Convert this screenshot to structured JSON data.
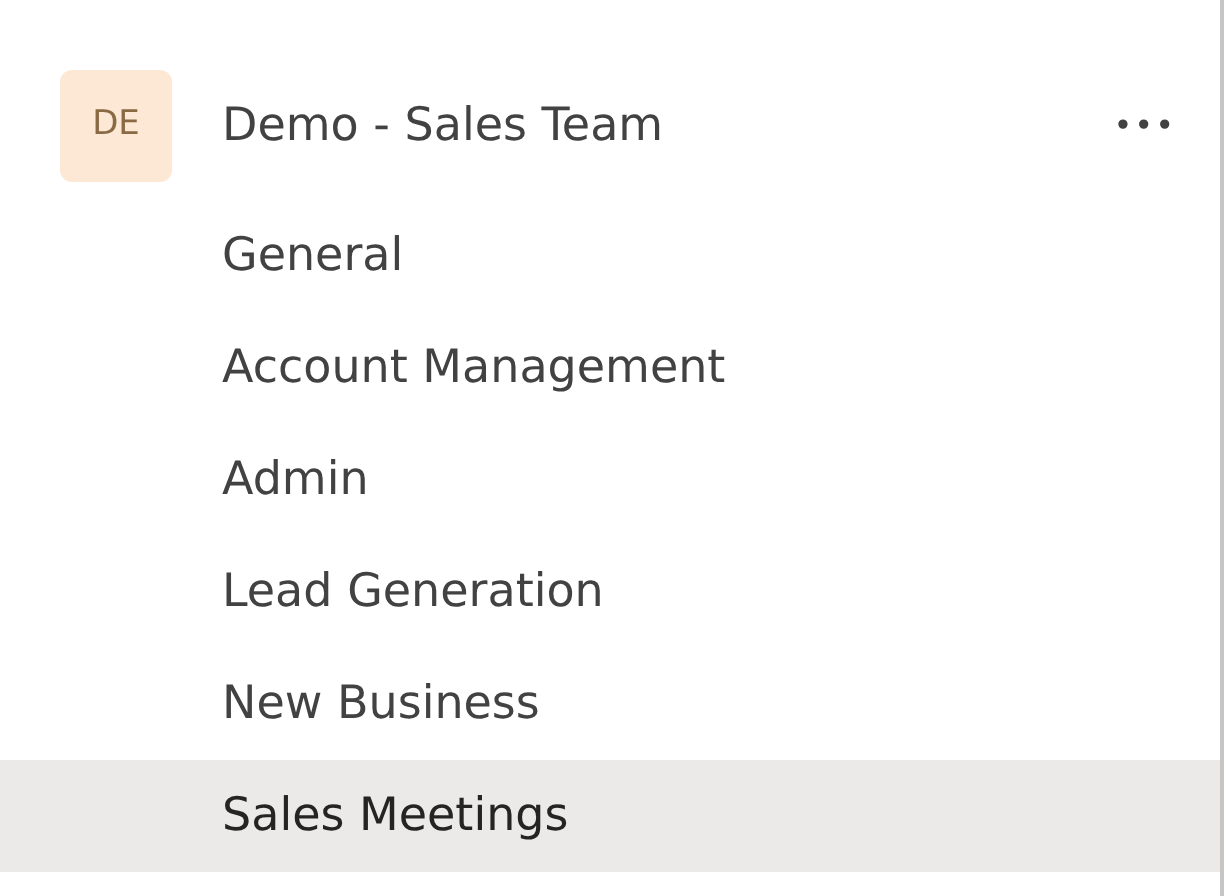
{
  "team": {
    "avatar": "DE",
    "name": "Demo - Sales Team",
    "more": "•••"
  },
  "channels": [
    {
      "name": "General",
      "selected": false
    },
    {
      "name": "Account Management",
      "selected": false
    },
    {
      "name": "Admin",
      "selected": false
    },
    {
      "name": "Lead Generation",
      "selected": false
    },
    {
      "name": "New Business",
      "selected": false
    },
    {
      "name": "Sales Meetings",
      "selected": true
    }
  ]
}
